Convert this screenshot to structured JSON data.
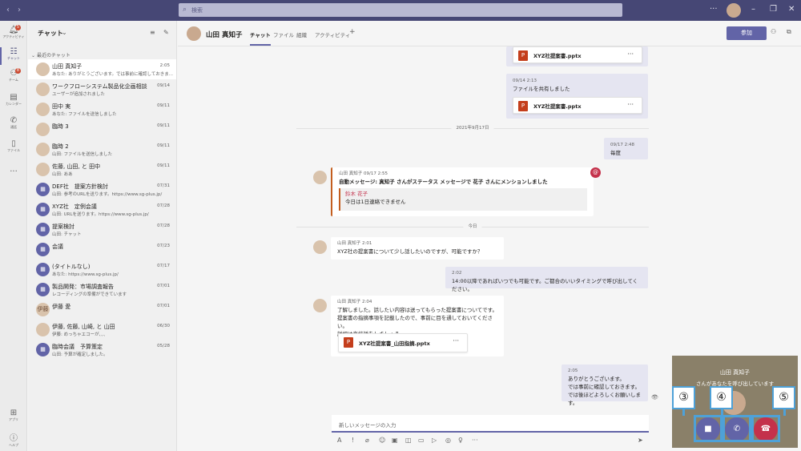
{
  "topbar": {
    "search_placeholder": "検索"
  },
  "rail": [
    {
      "label": "アクティビティ",
      "icon": "bell-icon",
      "badge": "5"
    },
    {
      "label": "チャット",
      "icon": "chat-icon",
      "badge": ""
    },
    {
      "label": "チーム",
      "icon": "teams-icon",
      "badge": "8"
    },
    {
      "label": "カレンダー",
      "icon": "calendar-icon",
      "badge": ""
    },
    {
      "label": "通話",
      "icon": "phone-icon",
      "badge": ""
    },
    {
      "label": "ファイル",
      "icon": "file-icon",
      "badge": ""
    },
    {
      "label": "...",
      "icon": "more-icon",
      "badge": ""
    },
    {
      "label": "アプリ",
      "icon": "apps-icon",
      "badge": ""
    },
    {
      "label": "ヘルプ",
      "icon": "help-icon",
      "badge": ""
    }
  ],
  "chatlist": {
    "title": "チャット",
    "section": "最近のチャット",
    "items": [
      {
        "name": "山田 真知子",
        "preview": "あなた: ありがとうございます。では事前に確認しておきま...",
        "time": "2:05",
        "av": "",
        "person": true
      },
      {
        "name": "ワークフローシステム製品化企画相談",
        "preview": "ユーザーが追加されました",
        "time": "09/14",
        "av": "",
        "person": true
      },
      {
        "name": "田中 実",
        "preview": "あなた: ファイルを送信しました",
        "time": "09/11",
        "av": "",
        "person": true
      },
      {
        "name": "臨時 3",
        "preview": "",
        "time": "09/11",
        "av": "",
        "person": true
      },
      {
        "name": "臨時 2",
        "preview": "山田: ファイルを送信しました",
        "time": "09/11",
        "av": "",
        "person": true
      },
      {
        "name": "佐藤, 山田, と 田中",
        "preview": "山田: ああ",
        "time": "09/11",
        "av": "",
        "person": true
      },
      {
        "name": "DEF社　提案方針検討",
        "preview": "山田: 参考のURLを送ります。https://www.sg-plus.jp/",
        "time": "07/31",
        "av": "▦",
        "person": false
      },
      {
        "name": "XYZ社　定例会議",
        "preview": "山田: URLを送ります。https://www.sg-plus.jp/",
        "time": "07/28",
        "av": "▦",
        "person": false
      },
      {
        "name": "提案検討",
        "preview": "山田: チャット",
        "time": "07/28",
        "av": "▦",
        "person": false
      },
      {
        "name": "会議",
        "preview": "",
        "time": "07/23",
        "av": "▦",
        "person": false
      },
      {
        "name": "(タイトルなし)",
        "preview": "あなた: https://www.sg-plus.jp/",
        "time": "07/17",
        "av": "▦",
        "person": false
      },
      {
        "name": "製品開発：市場調査報告",
        "preview": "レコーディングの準備ができています",
        "time": "07/01",
        "av": "▦",
        "person": false
      },
      {
        "name": "伊藤 愛",
        "preview": "",
        "time": "07/01",
        "av": "伊藤",
        "person": true
      },
      {
        "name": "伊藤, 佐藤, 山崎, と 山田",
        "preview": "伊藤: めっちゃエコーが、、、",
        "time": "06/30",
        "av": "",
        "person": true
      },
      {
        "name": "臨時会議　予算策定",
        "preview": "山田: 予算が確定しました。",
        "time": "05/28",
        "av": "▦",
        "person": false
      }
    ]
  },
  "header": {
    "title": "山田 真知子",
    "tabs": [
      "チャット",
      "ファイル",
      "組織",
      "アクティビティ",
      "+"
    ],
    "join_label": "参加"
  },
  "messages": {
    "file1": "XYZ社提案書.pptx",
    "m2_time": "09/14 2:13",
    "m2_text": "ファイルを共有しました",
    "file2": "XYZ社提案書.pptx",
    "sep1": "2021年9月17日",
    "m3_time": "09/17 2:48",
    "m3_text": "毎度",
    "m4_meta": "山田 真知子   09/17 2:55",
    "m4_text": "自動メッセージ: 真知子 さんがステータス メッセージで 花子 さんにメンションしました",
    "m4_quote_name": "鈴木 花子",
    "m4_quote_text": "今日は1日連絡できません",
    "sep2": "今日",
    "m5_meta": "山田 真知子   2:01",
    "m5_text": "XYZ社の提案書について少し話したいのですが、可能ですか？",
    "m6_time": "2:02",
    "m6_text": "14:00以降であればいつでも可能です。ご都合のいいタイミングで呼び出してください。",
    "m7_meta": "山田 真知子   2:04",
    "m7_l1": "了解しました。話したい内容は送ってもらった提案書についてです。",
    "m7_l2": "提案書の指摘事項を記載したので、事前に目を通しておいてください。",
    "m7_l3": "詳細は直接話をしましょう。",
    "file3": "XYZ社提案書_山田指摘.pptx",
    "m8_time": "2:05",
    "m8_l1": "ありがとうございます。",
    "m8_l2": "では事前に確認しておきます。",
    "m8_l3": "では後ほどよろしくお願いします。",
    "more": "···"
  },
  "compose": {
    "placeholder": "新しいメッセージの入力"
  },
  "call": {
    "name": "山田 真知子",
    "status": "さんがあなたを呼び出しています",
    "labels": [
      "③",
      "④",
      "⑤"
    ],
    "colors": {
      "video": "#6264a7",
      "audio": "#6264a7",
      "decline": "#c4314b",
      "callout": "#4ea1d8"
    }
  }
}
